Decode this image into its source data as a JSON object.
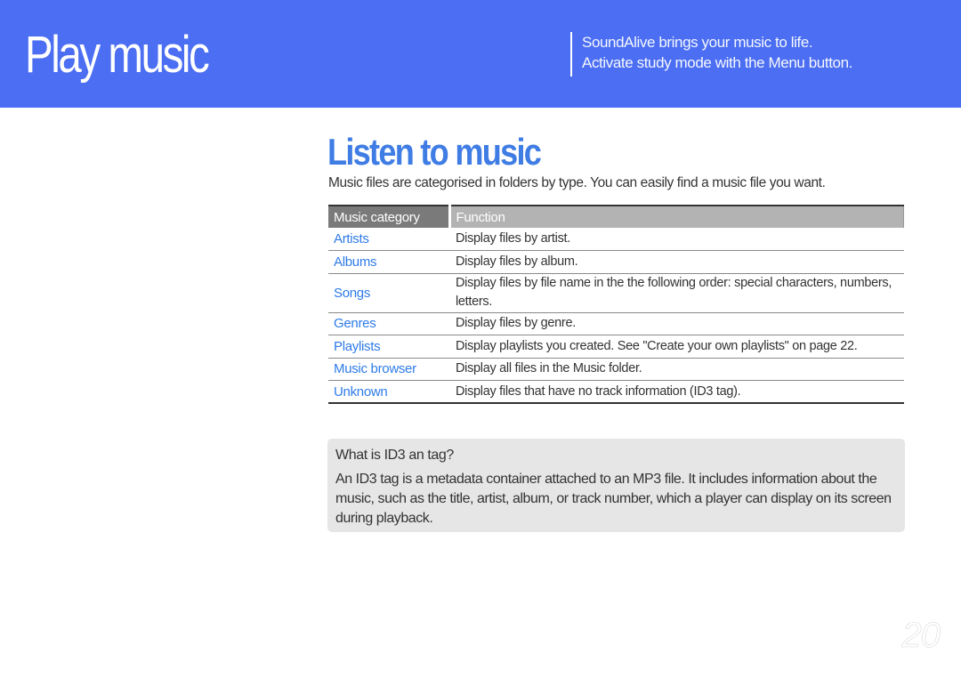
{
  "colors": {
    "brand": "#4b6ef2",
    "section_title": "#3f7de4",
    "link_text": "#2f7be8",
    "table_header_dark": "#7a7a7a",
    "table_header_light": "#b3b3b3",
    "note_background": "#e6e6e6"
  },
  "banner": {
    "title": "Play music",
    "tagline": [
      "SoundAlive brings your music to life.",
      "Activate study mode with the Menu button."
    ]
  },
  "section": {
    "title": "Listen to music",
    "intro": "Music files are categorised in folders by type. You can easily find a music file you want."
  },
  "table": {
    "headers": [
      "Music category",
      "Function"
    ],
    "rows": [
      {
        "category": "Artists",
        "function": "Display files by artist."
      },
      {
        "category": "Albums",
        "function": "Display files by album."
      },
      {
        "category": "Songs",
        "function": "Display files by file name in the the following order: special characters, numbers, letters."
      },
      {
        "category": "Genres",
        "function": "Display files by genre."
      },
      {
        "category": "Playlists",
        "function": "Display playlists you created. See \"Create your own playlists\" on page 22."
      },
      {
        "category": "Music browser",
        "function": "Display all files in the Music folder."
      },
      {
        "category": "Unknown",
        "function": "Display files that have no track information (ID3 tag)."
      }
    ]
  },
  "note": {
    "title": "What is ID3 an tag?",
    "body": "An ID3 tag is a metadata container attached to an MP3 file. It includes information about the music, such as the title, artist, album, or track number, which a player can display on its screen during playback."
  },
  "page_number": "20"
}
